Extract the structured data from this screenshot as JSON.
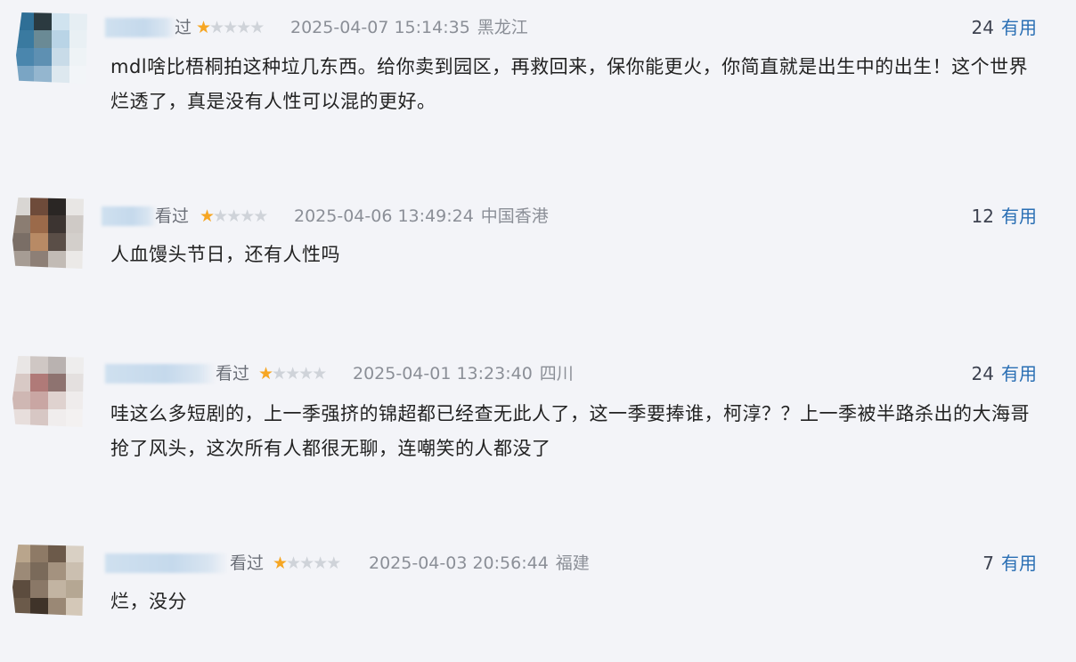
{
  "comments": [
    {
      "status": "过",
      "stars_on": 1,
      "stars_total": 5,
      "date": "2025-04-07 15:14:35",
      "location": "黑龙江",
      "useful_count": "24",
      "useful_label": "有用",
      "text": "mdl啥比梧桐拍这种垃几东西。给你卖到园区，再救回来，保你能更火，你简直就是出生中的出生！这个世界烂透了，真是没有人性可以混的更好。",
      "avatar_colors": [
        "#2f6f96",
        "#2b3a40",
        "#d0e3ef",
        "#e6eef3",
        "#3a7aa0",
        "#6a8a95",
        "#b9d4e6",
        "#e9f0f4",
        "#4a86ad",
        "#5e90b2",
        "#c8dbe8",
        "#eef3f6",
        "#7aa5c4",
        "#94b6cf",
        "#dde8ef",
        "#f2f5f8"
      ]
    },
    {
      "status": "看过",
      "stars_on": 1,
      "stars_total": 5,
      "date": "2025-04-06 13:49:24",
      "location": "中国香港",
      "useful_count": "12",
      "useful_label": "有用",
      "text": "人血馒头节日，还有人性吗",
      "avatar_colors": [
        "#d9d6d3",
        "#6e4b3a",
        "#2a2624",
        "#e8e6e4",
        "#8b7d72",
        "#9b6a4a",
        "#3c3431",
        "#cfcac6",
        "#7a6e66",
        "#b88a65",
        "#5a4e47",
        "#d3cfcb",
        "#a69c94",
        "#8d7f76",
        "#c2bbb5",
        "#ebe9e7"
      ]
    },
    {
      "status": "看过",
      "stars_on": 1,
      "stars_total": 5,
      "date": "2025-04-01 13:23:40",
      "location": "四川",
      "useful_count": "24",
      "useful_label": "有用",
      "text": "哇这么多短剧的，上一季强挤的锦超都已经查无此人了，这一季要捧谁，柯淳？？上一季被半路杀出的大海哥抢了风头，这次所有人都很无聊，连嘲笑的人都没了",
      "avatar_colors": [
        "#e9e6e5",
        "#cfc7c4",
        "#b9b2b0",
        "#eeeded",
        "#d8c9c5",
        "#b07a78",
        "#8e7370",
        "#e4e0df",
        "#cfb7b3",
        "#c9a6a3",
        "#dfd2cf",
        "#efecec",
        "#e7dedc",
        "#d7c7c4",
        "#f0eded",
        "#f3f1f1"
      ]
    },
    {
      "status": "看过",
      "stars_on": 1,
      "stars_total": 5,
      "date": "2025-04-03 20:56:44",
      "location": "福建",
      "useful_count": "7",
      "useful_label": "有用",
      "text": "烂，没分",
      "avatar_colors": [
        "#b9a58c",
        "#8e7a66",
        "#6c5a4a",
        "#d9d0c4",
        "#9c8a77",
        "#7a6a5a",
        "#a4927f",
        "#cbbfb0",
        "#5c4c3e",
        "#8a7867",
        "#c2b4a2",
        "#b5a793",
        "#6b5a4a",
        "#3f3329",
        "#9a8875",
        "#d4c8b8"
      ]
    }
  ]
}
